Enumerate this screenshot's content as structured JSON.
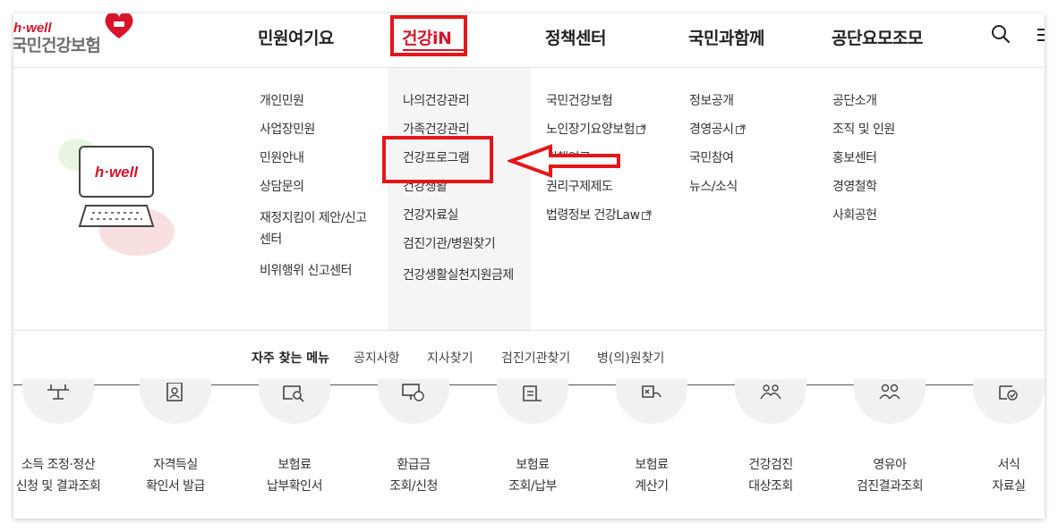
{
  "logo": {
    "hwell": "h·well",
    "name": "국민건강보험"
  },
  "gnb": [
    {
      "label": "민원여기요"
    },
    {
      "label": "건강iN"
    },
    {
      "label": "정책센터"
    },
    {
      "label": "국민과함께"
    },
    {
      "label": "공단요모조모"
    }
  ],
  "icons": {
    "search": "search-icon",
    "menu": "hamburger-menu-icon",
    "external": "external-link-icon"
  },
  "illustration": {
    "badge": "h·well"
  },
  "menu_columns": {
    "minwon": [
      {
        "label": "개인민원"
      },
      {
        "label": "사업장민원"
      },
      {
        "label": "민원안내"
      },
      {
        "label": "상담문의"
      },
      {
        "label": "재정지킴이 제안/신고센터"
      },
      {
        "label": "비위행위 신고센터"
      }
    ],
    "health": [
      {
        "label": "나의건강관리"
      },
      {
        "label": "가족건강관리"
      },
      {
        "label": "건강프로그램"
      },
      {
        "label": "건강생활"
      },
      {
        "label": "건강자료실"
      },
      {
        "label": "검진기관/병원찾기"
      },
      {
        "label": "건강생활실천지원금제"
      }
    ],
    "policy": [
      {
        "label": "국민건강보험"
      },
      {
        "label": "노인장기요양보험"
      },
      {
        "label": "정책연구"
      },
      {
        "label": "권리구제제도"
      },
      {
        "label": "법령정보 건강Law"
      }
    ],
    "together": [
      {
        "label": "정보공개"
      },
      {
        "label": "경영공시"
      },
      {
        "label": "국민참여"
      },
      {
        "label": "뉴스/소식"
      }
    ],
    "about": [
      {
        "label": "공단소개"
      },
      {
        "label": "조직 및 인원"
      },
      {
        "label": "홍보센터"
      },
      {
        "label": "경영철학"
      },
      {
        "label": "사회공헌"
      }
    ]
  },
  "quick_menu": {
    "title": "자주 찾는 메뉴",
    "links": [
      "공지사항",
      "지사찾기",
      "검진기관찾기",
      "병(의)원찾기"
    ]
  },
  "services": [
    {
      "line1": "소득 조정·정산",
      "line2": "신청 및 결과조회"
    },
    {
      "line1": "자격득실",
      "line2": "확인서 발급"
    },
    {
      "line1": "보험료",
      "line2": "납부확인서"
    },
    {
      "line1": "환급금",
      "line2": "조회/신청"
    },
    {
      "line1": "보험료",
      "line2": "조회/납부"
    },
    {
      "line1": "보험료",
      "line2": "계산기"
    },
    {
      "line1": "건강검진",
      "line2": "대상조회"
    },
    {
      "line1": "영유아",
      "line2": "검진결과조회"
    },
    {
      "line1": "서식",
      "line2": "자료실"
    }
  ],
  "colors": {
    "brand_red": "#d7142a",
    "annotation_red": "#e5161a",
    "active_col_bg": "#f5f5f5"
  }
}
